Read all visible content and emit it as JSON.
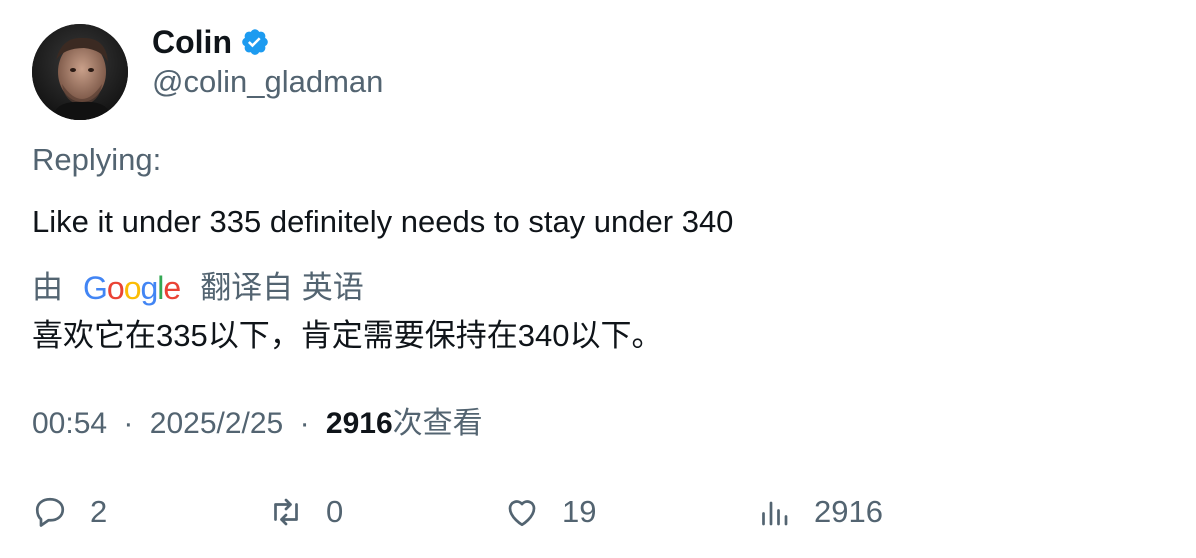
{
  "author": {
    "name": "Colin",
    "handle": "@colin_gladman",
    "verified_color": "#1d9bf0"
  },
  "replying_label": "Replying:",
  "tweet_text": "Like it under 335 definitely needs to stay under 340",
  "translation": {
    "prefix": "由",
    "provider_logo": "Google",
    "suffix": "翻译自 英语",
    "text": "喜欢它在335以下，肯定需要保持在340以下。"
  },
  "meta": {
    "time": "00:54",
    "separator": "·",
    "date": "2025/2/25",
    "views_count": "2916",
    "views_label": "次查看"
  },
  "actions": {
    "replies": "2",
    "retweets": "0",
    "likes": "19",
    "views": "2916"
  }
}
